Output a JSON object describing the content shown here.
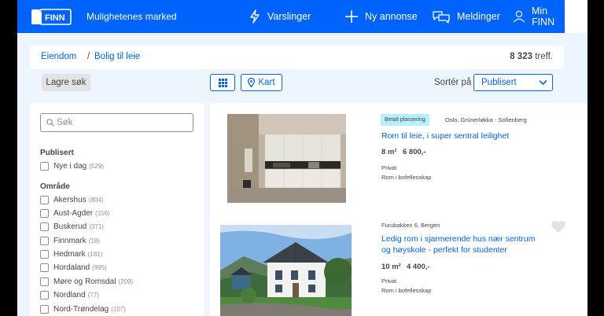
{
  "header": {
    "logo_text": "FINN",
    "tagline": "Mulighetenes marked",
    "nav": [
      {
        "label": "Varslinger",
        "icon": "bolt-icon"
      },
      {
        "label": "Ny annonse",
        "icon": "plus-icon"
      },
      {
        "label": "Meldinger",
        "icon": "chat-icon"
      },
      {
        "label": "Min FINN",
        "icon": "user-icon"
      }
    ],
    "brand_color": "#0063fb"
  },
  "breadcrumb": {
    "items": [
      "Eiendom",
      "Bolig til leie"
    ],
    "separator": "/"
  },
  "results_count": {
    "number": "8 323",
    "suffix": "treff."
  },
  "toolbar": {
    "save_search": "Lagre søk",
    "grid_icon": "grid-icon",
    "map_label": "Kart",
    "sort_label": "Sortér på",
    "sort_value": "Publisert"
  },
  "filters": {
    "search_placeholder": "Søk",
    "published": {
      "title": "Publisert",
      "options": [
        {
          "label": "Nye i dag",
          "count": "(529)"
        }
      ]
    },
    "area": {
      "title": "Område",
      "options": [
        {
          "label": "Akershus",
          "count": "(804)"
        },
        {
          "label": "Aust-Agder",
          "count": "(156)"
        },
        {
          "label": "Buskerud",
          "count": "(371)"
        },
        {
          "label": "Finnmark",
          "count": "(18)"
        },
        {
          "label": "Hedmark",
          "count": "(181)"
        },
        {
          "label": "Hordaland",
          "count": "(995)"
        },
        {
          "label": "Møre og Romsdal",
          "count": "(209)"
        },
        {
          "label": "Nordland",
          "count": "(77)"
        },
        {
          "label": "Nord-Trøndelag",
          "count": "(107)"
        }
      ]
    }
  },
  "listings": [
    {
      "badge": "Betalt plassering",
      "location": "Oslo, Grünerløkka - Sofienberg",
      "title": "Rom til leie, i super sentral leilighet",
      "size": "8 m²",
      "price": "6 800,-",
      "seller": "Privat",
      "type": "Rom i bofellesskap"
    },
    {
      "location": "Furubakken 6, Bergen",
      "title_lines": [
        "Ledig rom i sjarmerende hus nær sentrum",
        "og høyskole - perfekt for studenter"
      ],
      "size": "10 m²",
      "price": "4 400,-",
      "seller": "Privat",
      "type": "Rom i bofellesskap"
    }
  ]
}
